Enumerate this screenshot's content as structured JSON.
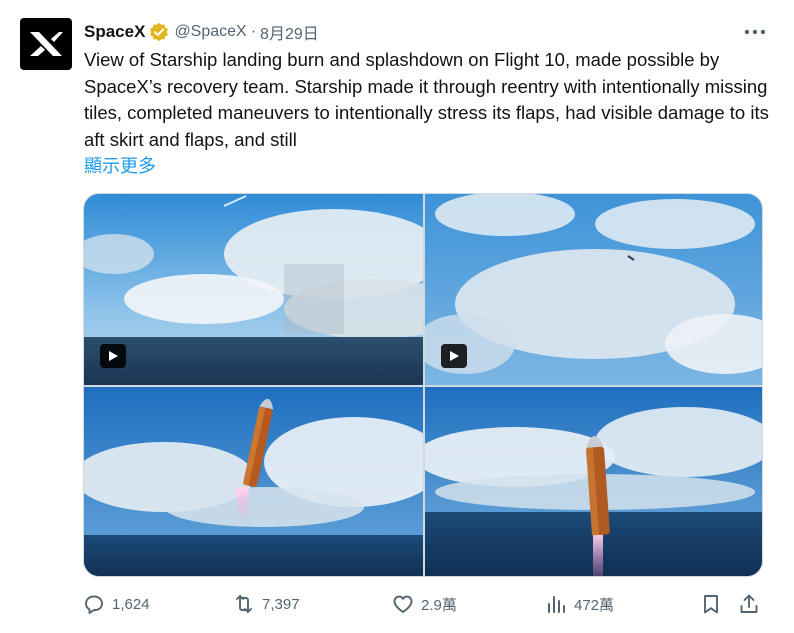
{
  "tweet": {
    "display_name": "SpaceX",
    "handle": "@SpaceX",
    "separator": "·",
    "date": "8月29日",
    "text": "View of Starship landing burn and splashdown on Flight 10, made possible by SpaceX’s recovery team. Starship made it through reentry with intentionally missing tiles, completed maneuvers to intentionally stress its flaps, had visible damage to its aft skirt and flaps, and still",
    "show_more": "顯示更多"
  },
  "media": [
    {
      "type": "video",
      "icon": "play-icon"
    },
    {
      "type": "video",
      "icon": "play-icon"
    },
    {
      "type": "image"
    },
    {
      "type": "image"
    }
  ],
  "actions": {
    "replies": "1,624",
    "retweets": "7,397",
    "likes": "2.9萬",
    "views": "472萬"
  },
  "colors": {
    "link": "#1d9bf0",
    "muted": "#536471",
    "verified": "#e2b719"
  }
}
